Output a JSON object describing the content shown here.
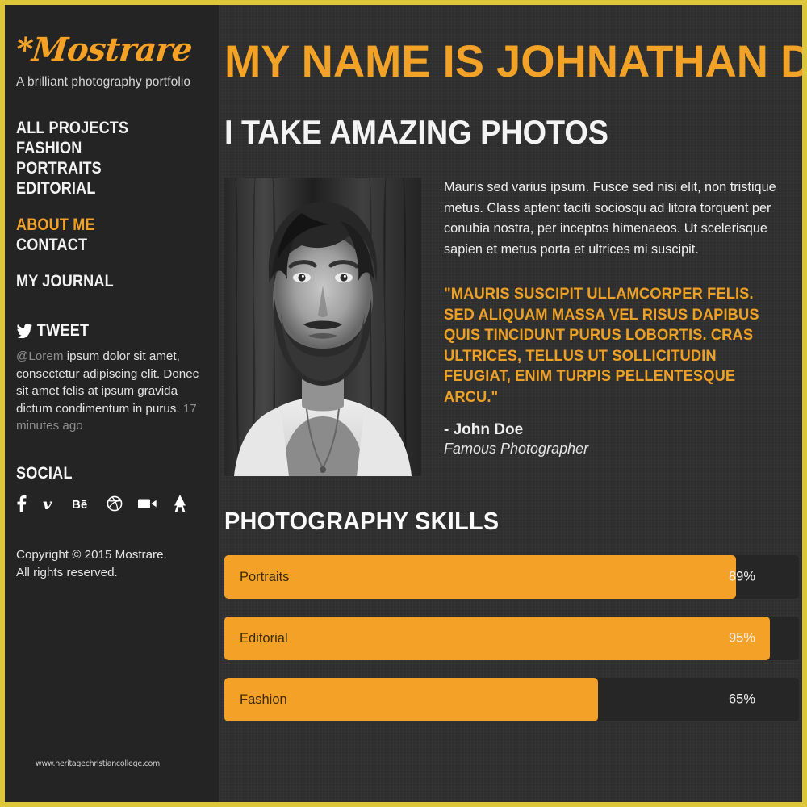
{
  "theme": {
    "accent": "#f4a227",
    "border": "#ddc63c",
    "sidebar_bg": "#242424",
    "main_bg": "#2e2e2e",
    "track_bg": "#262626"
  },
  "sidebar": {
    "logo": "*Mostrare",
    "tagline": "A brilliant photography portfolio",
    "nav_primary": [
      {
        "label": "ALL PROJECTS",
        "active": false
      },
      {
        "label": "FASHION",
        "active": false
      },
      {
        "label": "PORTRAITS",
        "active": false
      },
      {
        "label": "EDITORIAL",
        "active": false
      }
    ],
    "nav_secondary": [
      {
        "label": "ABOUT ME",
        "active": true
      },
      {
        "label": "CONTACT",
        "active": false
      }
    ],
    "nav_tertiary": [
      {
        "label": "MY JOURNAL",
        "active": false
      }
    ],
    "tweet": {
      "heading": "TWEET",
      "icon": "twitter-bird-icon",
      "handle": "@Lorem",
      "text": " ipsum dolor sit amet, consectetur adipiscing elit. Donec sit amet felis at ipsum gravida dictum condimentum in purus. ",
      "time": "17 minutes ago"
    },
    "social": {
      "heading": "SOCIAL",
      "items": [
        {
          "name": "facebook-icon",
          "glyph": "f"
        },
        {
          "name": "vimeo-icon",
          "glyph": "v"
        },
        {
          "name": "behance-icon",
          "glyph": "Bē"
        },
        {
          "name": "dribbble-icon",
          "glyph": ""
        },
        {
          "name": "video-camera-icon",
          "glyph": ""
        },
        {
          "name": "forrst-icon",
          "glyph": ""
        }
      ]
    },
    "copyright_line1": "Copyright © 2015 Mostrare.",
    "copyright_line2": "All rights reserved.",
    "watermark": "www.heritagechristiancollege.com"
  },
  "main": {
    "headline": "MY NAME IS JOHNATHAN DOE",
    "subheadline": "I TAKE AMAZING PHOTOS",
    "portrait_alt": "black-and-white portrait of bearded man",
    "about_paragraph": "Mauris sed varius ipsum. Fusce sed nisi elit, non tristique metus. Class aptent taciti sociosqu ad litora torquent per conubia nostra, per inceptos himenaeos. Ut scelerisque sapien et metus porta et ultrices mi suscipit.",
    "quote": "\"MAURIS SUSCIPIT ULLAMCORPER FELIS. SED ALIQUAM MASSA VEL RISUS DAPIBUS QUIS TINCIDUNT PURUS LOBORTIS. CRAS ULTRICES, TELLUS UT SOLLICITUDIN FEUGIAT, ENIM TURPIS PELLENTESQUE ARCU.\"",
    "quote_author": "- John Doe",
    "quote_role": "Famous Photographer",
    "skills_title": "PHOTOGRAPHY SKILLS"
  },
  "chart_data": {
    "type": "bar",
    "title": "PHOTOGRAPHY SKILLS",
    "orientation": "horizontal",
    "categories": [
      "Portraits",
      "Editorial",
      "Fashion"
    ],
    "values": [
      89,
      95,
      65
    ],
    "value_labels": [
      "89%",
      "95%",
      "65%"
    ],
    "xlabel": "",
    "ylabel": "",
    "xlim": [
      0,
      100
    ],
    "unit": "%",
    "grid": false,
    "legend": "none",
    "bar_color": "#f4a227",
    "track_color": "#262626"
  }
}
